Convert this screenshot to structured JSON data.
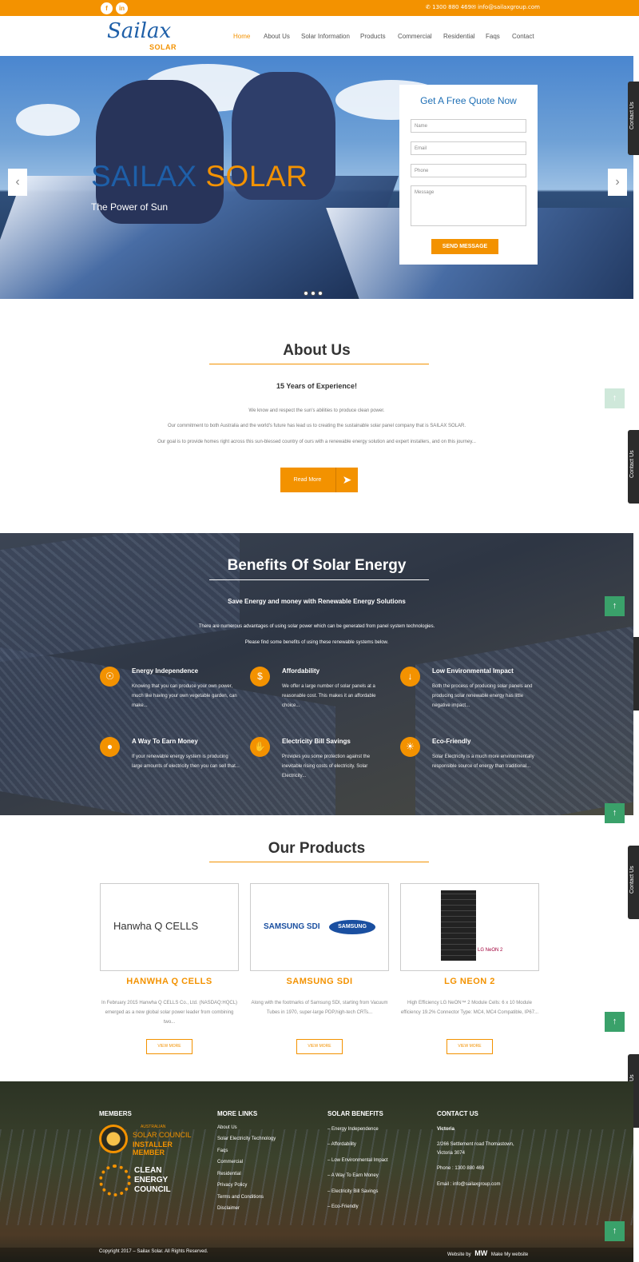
{
  "topbar": {
    "facebook": "f",
    "linkedin": "in",
    "phone": "✆ 1300 880 469",
    "email": "✉ info@sailaxgroup.com"
  },
  "header": {
    "logo_word": "Sailax",
    "logo_sub": "SOLAR",
    "nav": [
      "Home",
      "About Us",
      "Solar Information",
      "Products",
      "Commercial",
      "Residential",
      "Faqs",
      "Contact"
    ]
  },
  "hero": {
    "title_part1": "SAILAX",
    "title_part2": "SOLAR",
    "subtitle": "The Power of Sun",
    "prev": "‹",
    "next": "›"
  },
  "quote_form": {
    "title": "Get A Free Quote Now",
    "name_placeholder": "Name",
    "email_placeholder": "Email",
    "phone_placeholder": "Phone",
    "message_placeholder": "Message",
    "button": "SEND MESSAGE"
  },
  "side_tab": "Contact Us",
  "up_arrow": "↑",
  "about": {
    "title": "About Us",
    "subtitle": "15 Years of Experience!",
    "p1": "We know and respect the sun's abilities to produce clean power.",
    "p2": "Our commitment to both Australia and the world's future has lead us to creating the sustainable solar panel company that is SAILAX SOLAR.",
    "p3": "Our goal is to provide homes right across this sun-blessed country of ours with a renewable energy solution and expert installers, and on this journey...",
    "button": "Read More"
  },
  "benefits": {
    "title": "Benefits Of Solar Energy",
    "subtitle": "Save Energy and money with Renewable Energy Solutions",
    "p1": "There are numerous advantages of using solar power which can be generated from panel system technologies.",
    "p2": "Please find some benefits of using these renewable systems below.",
    "items": [
      {
        "name": "Energy Independence",
        "desc": "Knowing that you can produce your own power, much like having your own vegetable garden, can make...",
        "icon": "☉"
      },
      {
        "name": "Affordability",
        "desc": "We offer a large number of solar panels at a reasonable cost. This makes it an affordable choice...",
        "icon": "$"
      },
      {
        "name": "Low Environmental Impact",
        "desc": "Both the process of producing solar panels and producing solar renewable energy has little negative impact...",
        "icon": "↓"
      },
      {
        "name": "A Way To Earn Money",
        "desc": "If your renewable energy system is producing large amounts of electricity then you can sell that...",
        "icon": "●"
      },
      {
        "name": "Electricity Bill Savings",
        "desc": "Provides you some protection against the inevitable rising costs of electricity. Solar Electricity...",
        "icon": "✋"
      },
      {
        "name": "Eco-Friendly",
        "desc": "Solar Electricity is a much more environmentally responsible source of energy than traditional...",
        "icon": "☀"
      }
    ]
  },
  "products": {
    "title": "Our Products",
    "items": [
      {
        "logo": "Hanwha Q CELLS",
        "name": "HANWHA Q CELLS",
        "desc": "In February 2015 Hanwha Q CELLS Co., Ltd. (NASDAQ:HQCL) emerged as a new global solar power leader from combining two...",
        "button": "VIEW MORE"
      },
      {
        "logo": "SAMSUNG SDI",
        "logo2": "SAMSUNG",
        "name": "SAMSUNG SDI",
        "desc": "Along with the footmarks of Samsung SDI, starting from Vacuum Tubes in 1970, super-large PDP,high-tech CRTs...",
        "button": "VIEW MORE"
      },
      {
        "logo": "LG NeON 2",
        "name": "LG NEON 2",
        "desc": "High Efficiency LG NeON™ 2 Module Cells: 6 x 10 Module efficiency 19.2% Connector Type: MC4, MC4 Compatible, IP67...",
        "button": "VIEW MORE"
      }
    ]
  },
  "footer": {
    "members_title": "MEMBERS",
    "member1_small": "AUSTRALIAN",
    "member1_line1": "SOLAR COUNCIL",
    "member1_line2": "INSTALLER MEMBER",
    "member2_line1": "CLEAN",
    "member2_line2": "ENERGY",
    "member2_line3": "COUNCIL",
    "more_title": "MORE LINKS",
    "more_links": [
      "About Us",
      "Solar Electricity Technology",
      "Faqs",
      "Commercial",
      "Residential",
      "Privacy Policy",
      "Terms and Conditions",
      "Disclaimer"
    ],
    "benefits_title": "SOLAR BENEFITS",
    "benefit_links": [
      "– Energy Independence",
      "– Affordability",
      "– Low Environmental Impact",
      "– A Way To Earn Money",
      "– Electricity Bill Savings",
      "– Eco-Friendly"
    ],
    "contact_title": "CONTACT US",
    "state": "Victoria",
    "address1": "2/266 Settlement road Thomastown,",
    "address2": "Victoria 3074",
    "phone": "Phone : 1300 880 469",
    "email": "Email : info@sailaxgroup.com",
    "copyright": "Copyright 2017 – Sailax Solar. All Rights Reserved.",
    "website_by": "Website by",
    "mw_logo": "MW",
    "make_my": "Make My website"
  }
}
